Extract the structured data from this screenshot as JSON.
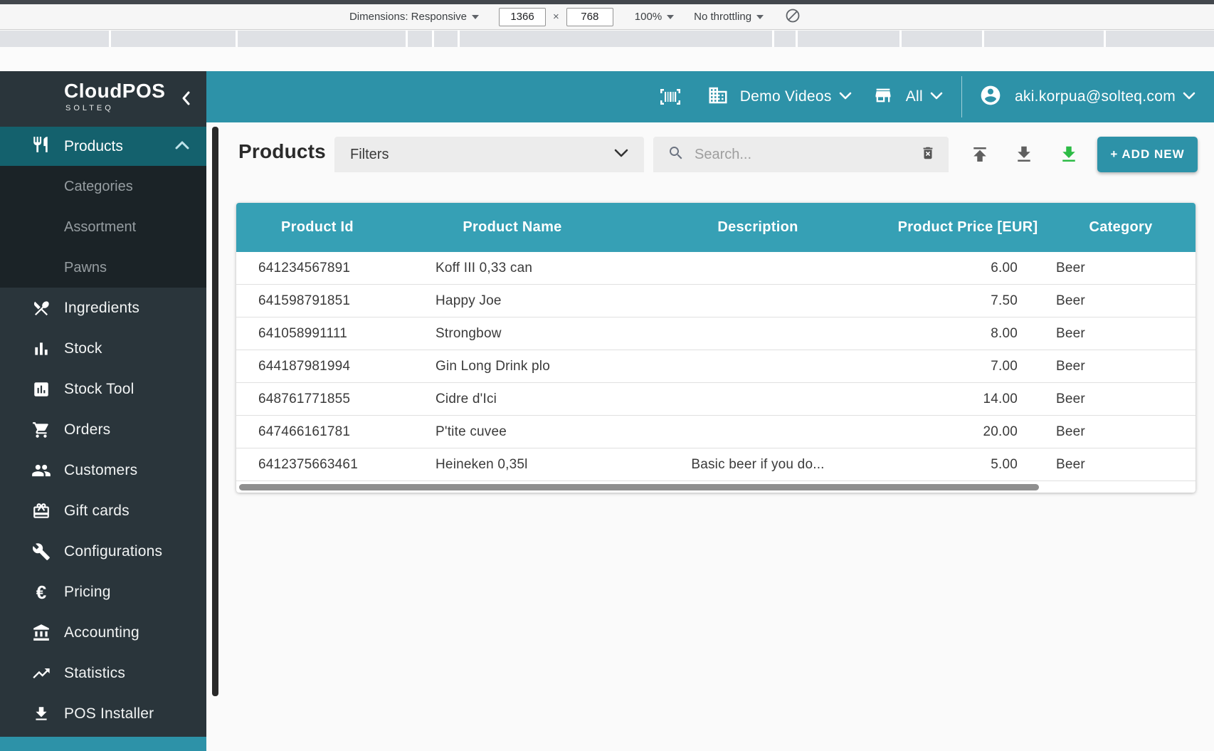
{
  "devtools": {
    "dimensions_label": "Dimensions: Responsive",
    "viewport_width": "1366",
    "viewport_height": "768",
    "multiply_sign": "×",
    "zoom_level": "100%",
    "throttling": "No throttling"
  },
  "app_header": {
    "company_selector": "Demo Videos",
    "store_selector": "All",
    "user_email": "aki.korpua@solteq.com",
    "accent_color": "#2d92a8"
  },
  "sidebar": {
    "logo_title": "CloudPOS",
    "logo_subtitle": "SOLTEQ",
    "products_label": "Products",
    "submenu": [
      {
        "label": "Categories"
      },
      {
        "label": "Assortment"
      },
      {
        "label": "Pawns"
      }
    ],
    "items": [
      {
        "icon": "restaurant-icon",
        "label": "Ingredients"
      },
      {
        "icon": "bar-chart-icon",
        "label": "Stock"
      },
      {
        "icon": "chart-box-icon",
        "label": "Stock Tool"
      },
      {
        "icon": "cart-icon",
        "label": "Orders"
      },
      {
        "icon": "people-icon",
        "label": "Customers"
      },
      {
        "icon": "gift-card-icon",
        "label": "Gift cards"
      },
      {
        "icon": "wrench-icon",
        "label": "Configurations"
      },
      {
        "icon": "euro-icon",
        "label": "Pricing"
      },
      {
        "icon": "bank-icon",
        "label": "Accounting"
      },
      {
        "icon": "trending-up-icon",
        "label": "Statistics"
      },
      {
        "icon": "download-icon",
        "label": "POS Installer"
      }
    ]
  },
  "toolbar": {
    "page_title": "Products",
    "filters_label": "Filters",
    "search_placeholder": "Search...",
    "add_new_label": "+ ADD NEW"
  },
  "table": {
    "columns": [
      "Product Id",
      "Product Name",
      "Description",
      "Product Price [EUR]",
      "Category"
    ],
    "rows": [
      [
        "641234567891",
        "Koff III 0,33 can",
        "",
        "6.00",
        "Beer"
      ],
      [
        "641598791851",
        "Happy Joe",
        "",
        "7.50",
        "Beer"
      ],
      [
        "641058991111",
        "Strongbow",
        "",
        "8.00",
        "Beer"
      ],
      [
        "644187981994",
        "Gin Long Drink plo",
        "",
        "7.00",
        "Beer"
      ],
      [
        "648761771855",
        "Cidre d'Ici",
        "",
        "14.00",
        "Beer"
      ],
      [
        "647466161781",
        "P'tite cuvee",
        "",
        "20.00",
        "Beer"
      ],
      [
        "6412375663461",
        "Heineken 0,35l",
        "Basic beer if you do...",
        "5.00",
        "Beer"
      ]
    ]
  }
}
